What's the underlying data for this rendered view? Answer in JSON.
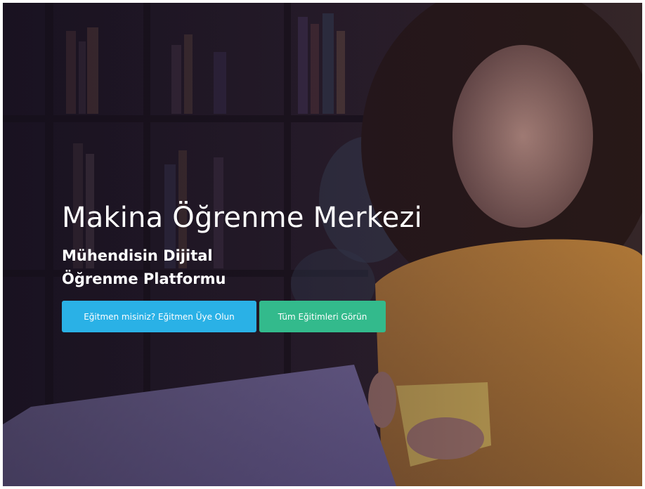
{
  "hero": {
    "title": "Makina Öğrenme Merkezi",
    "subtitle_line1": "Mühendisin Dijital",
    "subtitle_line2": "Öğrenme Platformu"
  },
  "actions": {
    "instructor_label": "Eğitmen misiniz? Eğitmen Üye Olun",
    "courses_label": "Tüm Eğitimleri Görün"
  },
  "colors": {
    "instructor_button": "#2ab1e6",
    "courses_button": "#33ba8c",
    "overlay": "#1a1320"
  }
}
